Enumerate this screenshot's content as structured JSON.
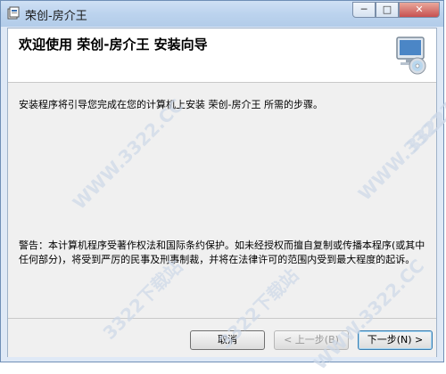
{
  "window": {
    "title": "荣创-房介王",
    "minimize_label": "─",
    "maximize_label": "□",
    "close_label": "✕"
  },
  "header": {
    "title": "欢迎使用 荣创-房介王 安装向导"
  },
  "body": {
    "intro": "安装程序将引导您完成在您的计算机上安装 荣创-房介王 所需的步骤。",
    "warning": "警告：本计算机程序受著作权法和国际条约保护。如未经授权而擅自复制或传播本程序(或其中任何部分)，将受到严厉的民事及刑事制裁，并将在法律许可的范围内受到最大程度的起诉。"
  },
  "buttons": {
    "cancel": "取消",
    "previous": "< 上一步(B)",
    "next": "下一步(N) >"
  },
  "watermarks": [
    "WWW.3322.CC",
    "WWW.3322.CC",
    "3322下载站",
    "3322下载站",
    "WWW.3322.CC",
    "3322下载站"
  ]
}
